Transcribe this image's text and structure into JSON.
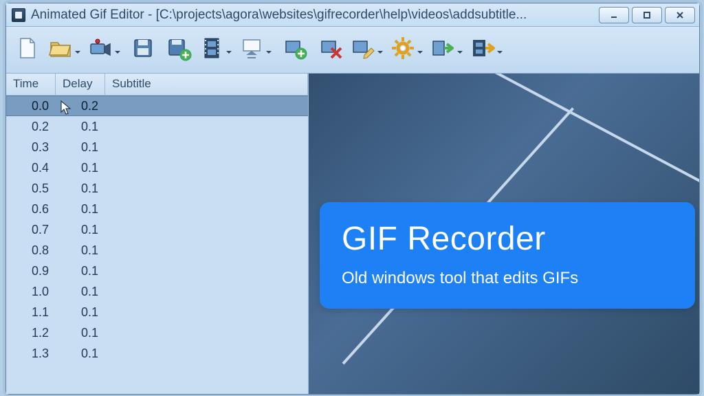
{
  "window": {
    "title": "Animated Gif Editor - [C:\\projects\\agora\\websites\\gifrecorder\\help\\videos\\addsubtitle..."
  },
  "toolbar": {
    "buttons": [
      {
        "name": "new-file-icon",
        "split": false
      },
      {
        "name": "open-folder-icon",
        "split": true
      },
      {
        "name": "camera-record-icon",
        "split": true
      },
      {
        "name": "save-icon",
        "split": false
      },
      {
        "name": "save-plus-icon",
        "split": false
      },
      {
        "name": "filmstrip-icon",
        "split": true
      },
      {
        "name": "projector-icon",
        "split": true
      },
      {
        "name": "add-frame-icon",
        "split": false
      },
      {
        "name": "remove-frame-icon",
        "split": false
      },
      {
        "name": "edit-frame-icon",
        "split": true
      },
      {
        "name": "settings-gear-icon",
        "split": true
      },
      {
        "name": "export-right-icon",
        "split": true
      },
      {
        "name": "export-film-icon",
        "split": true
      }
    ]
  },
  "frames": {
    "headers": {
      "time": "Time",
      "delay": "Delay",
      "subtitle": "Subtitle"
    },
    "rows": [
      {
        "time": "0.0",
        "delay": "0.2",
        "subtitle": "",
        "selected": true
      },
      {
        "time": "0.2",
        "delay": "0.1",
        "subtitle": ""
      },
      {
        "time": "0.3",
        "delay": "0.1",
        "subtitle": ""
      },
      {
        "time": "0.4",
        "delay": "0.1",
        "subtitle": ""
      },
      {
        "time": "0.5",
        "delay": "0.1",
        "subtitle": ""
      },
      {
        "time": "0.6",
        "delay": "0.1",
        "subtitle": ""
      },
      {
        "time": "0.7",
        "delay": "0.1",
        "subtitle": ""
      },
      {
        "time": "0.8",
        "delay": "0.1",
        "subtitle": ""
      },
      {
        "time": "0.9",
        "delay": "0.1",
        "subtitle": ""
      },
      {
        "time": "1.0",
        "delay": "0.1",
        "subtitle": ""
      },
      {
        "time": "1.1",
        "delay": "0.1",
        "subtitle": ""
      },
      {
        "time": "1.2",
        "delay": "0.1",
        "subtitle": ""
      },
      {
        "time": "1.3",
        "delay": "0.1",
        "subtitle": ""
      }
    ]
  },
  "overlay": {
    "title": "GIF Recorder",
    "subtitle": "Old windows tool that edits GIFs"
  },
  "colors": {
    "accent": "#1e80f5",
    "selection": "#7a9cc0"
  }
}
